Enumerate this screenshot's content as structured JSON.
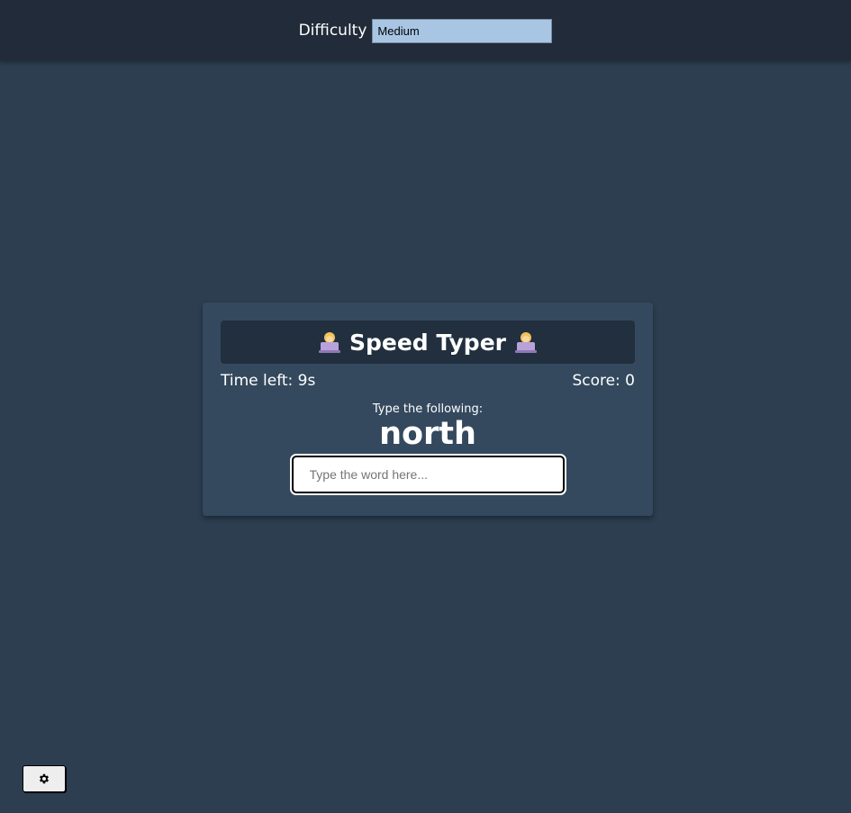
{
  "settings": {
    "difficulty_label": "Difficulty",
    "difficulty_value": "Medium",
    "select_bg": "#a8c6e4"
  },
  "game": {
    "title": "Speed Typer",
    "title_icon": "technologist-emoji",
    "time_label": "Time left: 9s",
    "score_label": "Score: 0",
    "prompt": "Type the following:",
    "word": "north",
    "input_placeholder": "Type the word here...",
    "input_value": ""
  },
  "footer": {
    "settings_button_icon": "gear-icon"
  },
  "colors": {
    "page_bg": "#2c3e50",
    "header_bg": "#212b39",
    "card_bg": "#34495e",
    "title_bg": "#212f3e",
    "text": "#ffffff"
  }
}
